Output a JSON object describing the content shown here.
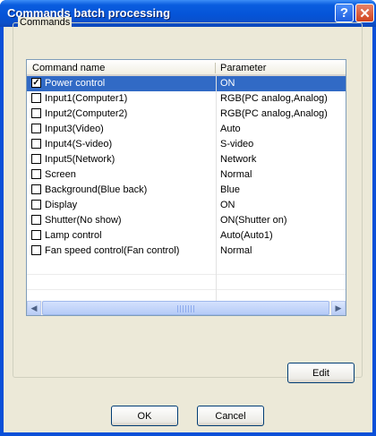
{
  "window": {
    "title": "Commands batch processing",
    "help_icon": "question-mark",
    "close_icon": "x"
  },
  "group": {
    "label": "Commands"
  },
  "table": {
    "columns": [
      "Command name",
      "Parameter"
    ],
    "rows": [
      {
        "name": "Power control",
        "param": "ON",
        "checked": true,
        "selected": true
      },
      {
        "name": "Input1(Computer1)",
        "param": "RGB(PC analog,Analog)",
        "checked": false
      },
      {
        "name": "Input2(Computer2)",
        "param": "RGB(PC analog,Analog)",
        "checked": false
      },
      {
        "name": "Input3(Video)",
        "param": "Auto",
        "checked": false
      },
      {
        "name": "Input4(S-video)",
        "param": "S-video",
        "checked": false
      },
      {
        "name": "Input5(Network)",
        "param": "Network",
        "checked": false
      },
      {
        "name": "Screen",
        "param": "Normal",
        "checked": false
      },
      {
        "name": "Background(Blue back)",
        "param": "Blue",
        "checked": false
      },
      {
        "name": "Display",
        "param": "ON",
        "checked": false
      },
      {
        "name": "Shutter(No show)",
        "param": "ON(Shutter on)",
        "checked": false
      },
      {
        "name": "Lamp control",
        "param": "Auto(Auto1)",
        "checked": false
      },
      {
        "name": "Fan speed control(Fan control)",
        "param": "Normal",
        "checked": false
      }
    ]
  },
  "buttons": {
    "edit": "Edit",
    "ok": "OK",
    "cancel": "Cancel"
  },
  "colors": {
    "titlebar": "#0554d8",
    "selection": "#316ac5",
    "dialog_bg": "#ece9d8"
  }
}
